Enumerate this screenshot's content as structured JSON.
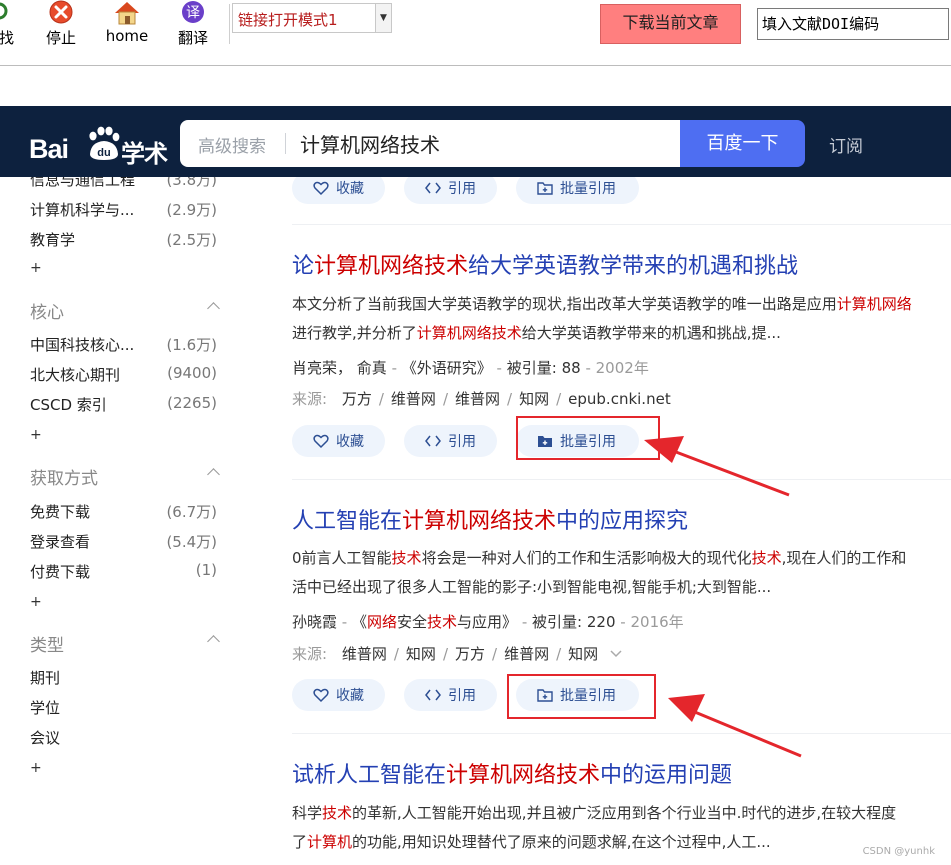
{
  "toolbar": {
    "buttons": [
      {
        "label": "找",
        "icon": "find-icon"
      },
      {
        "label": "停止",
        "icon": "stop-icon"
      },
      {
        "label": "home",
        "icon": "home-icon"
      },
      {
        "label": "翻译",
        "icon": "translate-icon",
        "icon_text": "译"
      }
    ],
    "mode_select": "链接打开模式1",
    "download_label": "下载当前文章",
    "doi_placeholder": "填入文献DOI编码"
  },
  "header": {
    "logo_text": "Bai",
    "logo_paw_text": "du",
    "logo_suffix": "学术",
    "advanced_search": "高级搜索",
    "query": "计算机网络技术",
    "search_button": "百度一下",
    "subscribe": "订阅"
  },
  "sidebar": {
    "partial_top": {
      "label": "信息与通信工程",
      "count": "(3.8万)"
    },
    "subject_items": [
      {
        "label": "计算机科学与...",
        "count": "(2.9万)"
      },
      {
        "label": "教育学",
        "count": "(2.5万)"
      }
    ],
    "more": "+",
    "sections": [
      {
        "title": "核心",
        "items": [
          {
            "label": "中国科技核心...",
            "count": "(1.6万)"
          },
          {
            "label": "北大核心期刊",
            "count": "(9400)"
          },
          {
            "label": "CSCD 索引",
            "count": "(2265)"
          }
        ]
      },
      {
        "title": "获取方式",
        "items": [
          {
            "label": "免费下载",
            "count": "(6.7万)"
          },
          {
            "label": "登录查看",
            "count": "(5.4万)"
          },
          {
            "label": "付费下载",
            "count": "(1)"
          }
        ]
      },
      {
        "title": "类型",
        "items": [
          {
            "label": "期刊",
            "count": ""
          },
          {
            "label": "学位",
            "count": ""
          },
          {
            "label": "会议",
            "count": ""
          }
        ]
      }
    ]
  },
  "actions": {
    "favorite": "收藏",
    "cite": "引用",
    "batch_cite": "批量引用"
  },
  "results": [
    {
      "title_parts": [
        "论",
        "计算机网络技术",
        "给大学英语教学带来的机遇和挑战"
      ],
      "abstract_line1": [
        "本文分析了当前我国大学英语教学的现状,指出改革大学英语教学的唯一出路是应用",
        "计算机网络"
      ],
      "abstract_line2": [
        "进行教学,并分析了",
        "计算机网络技术",
        "给大学英语教学带来的机遇和挑战,提..."
      ],
      "authors": "肖亮荣， 俞真",
      "journal": "《外语研究》",
      "cited_label": "被引量:",
      "cited": "88",
      "year": "2002年",
      "source_label": "来源:",
      "sources": [
        "万方",
        "维普网",
        "维普网",
        "知网",
        "epub.cnki.net"
      ]
    },
    {
      "title_parts": [
        "人工智能在",
        "计算机网络技术",
        "中的应用探究"
      ],
      "abstract_line1": [
        "0前言人工智能",
        "技术",
        "将会是一种对人们的工作和生活影响极大的现代化",
        "技术",
        ",现在人们的工作和"
      ],
      "abstract_line2": [
        "活中已经出现了很多人工智能的影子:小到智能电视,智能手机;大到智能..."
      ],
      "authors": "孙晓霞",
      "journal_parts": [
        "《",
        "网络",
        "安全",
        "技术",
        "与应用》"
      ],
      "cited_label": "被引量:",
      "cited": "220",
      "year": "2016年",
      "source_label": "来源:",
      "sources": [
        "维普网",
        "知网",
        "万方",
        "维普网",
        "知网"
      ]
    },
    {
      "title_parts": [
        "试析人工智能在",
        "计算机网络技术",
        "中的运用问题"
      ],
      "abstract_line1": [
        "科学",
        "技术",
        "的革新,人工智能开始出现,并且被广泛应用到各个行业当中.时代的进步,在较大程度"
      ],
      "abstract_line2": [
        "了",
        "计算机",
        "的功能,用知识处理替代了原来的问题求解,在这个过程中,人工..."
      ]
    }
  ],
  "watermark": "CSDN @yunhk",
  "colors": {
    "header_bg": "#0d213e",
    "search_button": "#4e6ef2",
    "title_link": "#2440b3",
    "highlight": "#cc0000",
    "annotation_red": "#e4262c",
    "download_button": "#ff7f7f"
  }
}
